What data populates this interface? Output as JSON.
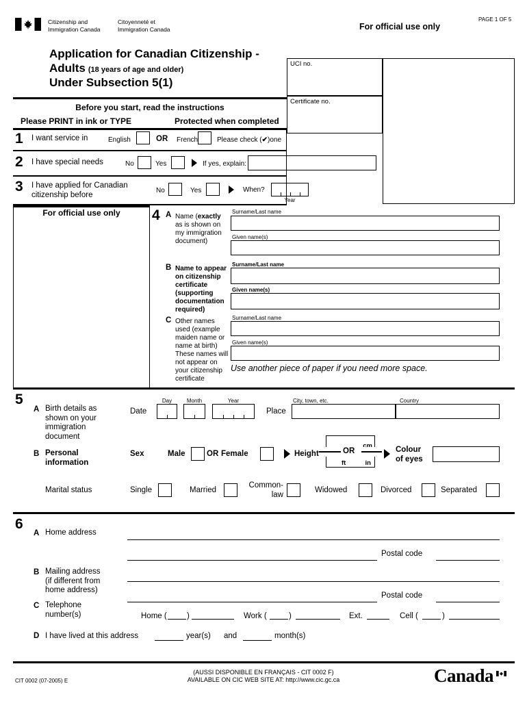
{
  "header": {
    "flag_icon": "canada-flag-icon",
    "dept_en_line1": "Citizenship and",
    "dept_en_line2": "Immigration Canada",
    "dept_fr_line1": "Citoyenneté et",
    "dept_fr_line2": "Immigration Canada",
    "official_use": "For official use only",
    "page_indicator": "PAGE 1 OF 5"
  },
  "title": {
    "line1": "Application for Canadian Citizenship -",
    "line2_bold": "Adults",
    "line2_rest": "(18 years of age and older)",
    "line3": "Under Subsection 5(1)",
    "before_start": "Before you start, read the instructions",
    "print_instruction": "Please PRINT in ink or TYPE",
    "protected": "Protected when completed"
  },
  "office_boxes": {
    "uci_label": "UCI no.",
    "certificate_label": "Certificate no."
  },
  "q1": {
    "number": "1",
    "text": "I want service in",
    "english": "English",
    "or": "OR",
    "french": "French",
    "check_one": "Please check (",
    "check_mark": "✔",
    "check_one_end": ")one"
  },
  "q2": {
    "number": "2",
    "text": "I have special needs",
    "no": "No",
    "yes": "Yes",
    "if_yes": "If yes, explain:",
    "explain_value": ""
  },
  "q3": {
    "number": "3",
    "text_line1": "I have applied for Canadian",
    "text_line2": "citizenship before",
    "no": "No",
    "yes": "Yes",
    "when": "When?",
    "year_label": "Year"
  },
  "official_left": {
    "heading": "For official use only"
  },
  "q4": {
    "number": "4",
    "a": {
      "letter": "A",
      "line1": "Name (",
      "line1_bold": "exactly",
      "line2": "as is shown on",
      "line3": "my immigration",
      "line4": "document)",
      "surname_label": "Surname/Last name",
      "given_label": "Given name(s)",
      "surname_value": "",
      "given_value": ""
    },
    "b": {
      "letter": "B",
      "line1": "Name to appear",
      "line2": "on citizenship",
      "line3": "certificate",
      "line4": "(supporting",
      "line5": "documentation",
      "line6": "required)",
      "surname_label": "Surname/Last name",
      "given_label": "Given name(s)",
      "surname_value": "",
      "given_value": ""
    },
    "c": {
      "letter": "C",
      "line1": "Other names",
      "line2": "used (example",
      "line3": "maiden name or",
      "line4": "name at birth)",
      "line5": "These names will",
      "line6": "not appear on",
      "line7": "your citizenship",
      "line8": "certificate",
      "surname_label": "Surname/Last name",
      "given_label": "Given name(s)",
      "surname_value": "",
      "given_value": ""
    },
    "note": "Use another piece of paper if you need more space."
  },
  "q5": {
    "number": "5",
    "a": {
      "letter": "A",
      "line1": "Birth details as",
      "line2": "shown on your",
      "line3": "immigration",
      "line4": "document",
      "date_label": "Date",
      "day_label": "Day",
      "month_label": "Month",
      "year_label": "Year",
      "place_label": "Place",
      "city_label": "City, town, etc.",
      "country_label": "Country",
      "day_value": "",
      "month_value": "",
      "year_value": "",
      "city_value": "",
      "country_value": ""
    },
    "b": {
      "letter": "B",
      "line1": "Personal",
      "line2": "information",
      "sex_label": "Sex",
      "male": "Male",
      "or": "OR",
      "female": "Female",
      "height_label": "Height",
      "cm": "cm",
      "height_or": "OR",
      "ft": "ft",
      "in": "in",
      "eyes_line1": "Colour",
      "eyes_line2": "of eyes",
      "eyes_value": ""
    },
    "marital": {
      "label": "Marital status",
      "options": [
        "Single",
        "Married",
        "Common-law",
        "Widowed",
        "Divorced",
        "Separated"
      ],
      "common_law_line1": "Common-",
      "common_law_line2": "law"
    }
  },
  "q6": {
    "number": "6",
    "a": {
      "letter": "A",
      "label": "Home address",
      "postal_label": "Postal code",
      "line1_value": "",
      "line2_value": "",
      "postal_value": ""
    },
    "b": {
      "letter": "B",
      "line1": "Mailing address",
      "line2": "(if different from",
      "line3": "home address)",
      "postal_label": "Postal code",
      "line1_value": "",
      "line2_value": "",
      "postal_value": ""
    },
    "c": {
      "letter": "C",
      "line1": "Telephone",
      "line2": "number(s)",
      "home": "Home (",
      "home_close": ")",
      "work": "Work (",
      "work_close": ")",
      "ext": "Ext.",
      "cell": "Cell (",
      "cell_close": ")"
    },
    "d": {
      "letter": "D",
      "text": "I have lived at this address",
      "years": "year(s)",
      "and": "and",
      "months": "month(s)"
    }
  },
  "footer": {
    "form_code": "CIT 0002 (07-2005) E",
    "french_note": "(AUSSI DISPONIBLE EN FRANÇAIS - CIT 0002 F)",
    "web_note": "AVAILABLE ON CIC WEB SITE AT: http://www.cic.gc.ca",
    "wordmark": "Canada"
  }
}
